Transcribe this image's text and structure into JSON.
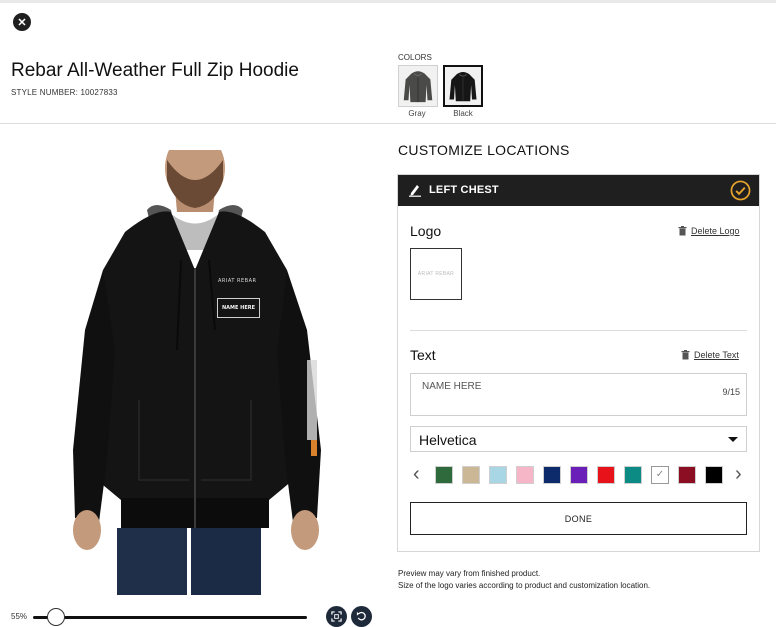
{
  "window": {
    "close_icon": "close-icon"
  },
  "product": {
    "title": "Rebar All-Weather Full Zip Hoodie",
    "style_number": "STYLE NUMBER: 10027833",
    "image_chest_brand": "ARIAT REBAR",
    "image_chest_text": "NAME HERE"
  },
  "colors": {
    "label": "COLORS",
    "options": [
      {
        "label": "Gray",
        "hex": "#4a4a48",
        "selected": false
      },
      {
        "label": "Black",
        "hex": "#161616",
        "selected": true
      }
    ]
  },
  "zoom": {
    "level": "55%",
    "value_percent": 55,
    "fit_icon": "fit-to-screen-icon",
    "reset_icon": "reset-icon"
  },
  "customize": {
    "title": "CUSTOMIZE LOCATIONS",
    "location": {
      "label": "LEFT CHEST",
      "icon": "pen-icon",
      "status_icon": "check-circle-icon",
      "status_color": "#e7a42d"
    },
    "logo": {
      "label": "Logo",
      "delete_label": "Delete Logo",
      "preview_text": "ARIAT REBAR"
    },
    "text": {
      "label": "Text",
      "delete_label": "Delete Text",
      "value": "NAME HERE",
      "counter": "9/15",
      "font": "Helvetica"
    },
    "thread_colors": [
      "#2f6a3c",
      "#cbb796",
      "#a9d6e5",
      "#f7b6c8",
      "#0d2a6b",
      "#6a1fb8",
      "#e8121a",
      "#0c8b85",
      "#ffffff",
      "#8b0e23",
      "#000000"
    ],
    "selected_color_index": 8,
    "done_label": "DONE"
  },
  "disclaimer": {
    "line1": "Preview may vary from finished product.",
    "line2": "Size of the logo varies according to product and customization location."
  }
}
